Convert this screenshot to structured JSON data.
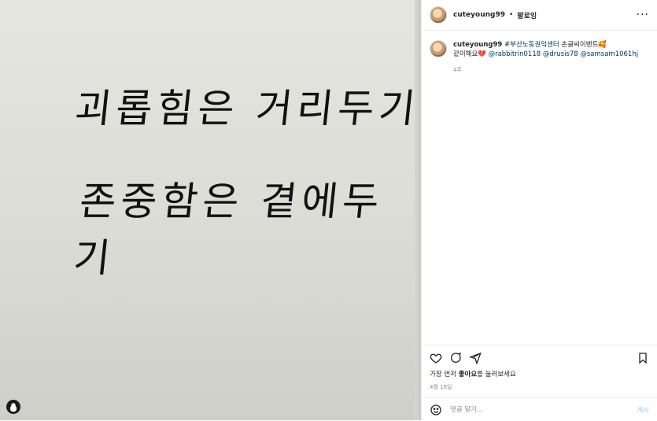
{
  "photo": {
    "line1": "괴롭힘은 거리두기",
    "line2": "존중함은 곁에두기"
  },
  "header": {
    "username": "cuteyoung99",
    "separator": "•",
    "follow_label": "팔로잉",
    "more_label": "···"
  },
  "caption": {
    "username": "cuteyoung99",
    "hashtag": "#부산노동권익센터",
    "text1": "손글씨이벤트🥰",
    "text2": "같이해요💔",
    "mentions": [
      "@rabbitrin0118",
      "@drusis78",
      "@samsam1061hj"
    ],
    "time_ago": "4주"
  },
  "actions": {
    "likes_prefix": "가장 먼저 ",
    "likes_strong": "좋아요",
    "likes_suffix": "를 눌러보세요",
    "date": "4월 18일"
  },
  "comment": {
    "placeholder": "댓글 달기...",
    "post_label": "게시"
  }
}
